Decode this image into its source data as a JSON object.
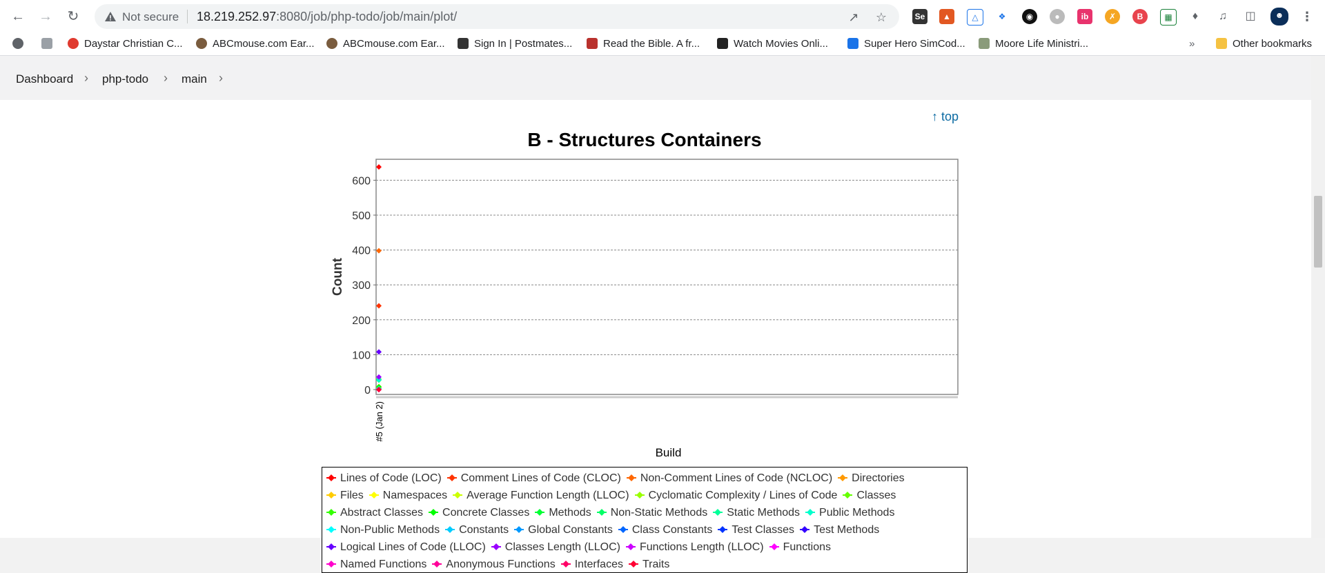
{
  "browser": {
    "url_host": "18.219.252.97",
    "url_rest": ":8080/job/php-todo/job/main/plot/",
    "security_label": "Not secure"
  },
  "bookmarks": [
    {
      "label": "Daystar Christian C...",
      "color": "#e03a2f"
    },
    {
      "label": "ABCmouse.com Ear...",
      "color": "#7a5c3e"
    },
    {
      "label": "ABCmouse.com Ear...",
      "color": "#7a5c3e"
    },
    {
      "label": "Sign In | Postmates...",
      "color": "#333333"
    },
    {
      "label": "Read the Bible. A fr...",
      "color": "#b9312d"
    },
    {
      "label": "Watch Movies Onli...",
      "color": "#222222"
    },
    {
      "label": "Super Hero SimCod...",
      "color": "#1a73e8"
    },
    {
      "label": "Moore Life Ministri...",
      "color": "#8a9b7a"
    }
  ],
  "other_bookmarks": "Other bookmarks",
  "overflow": "»",
  "breadcrumb": [
    "Dashboard",
    "php-todo",
    "main"
  ],
  "top_link": "top",
  "chart_data": {
    "type": "line",
    "title": "B - Structures Containers",
    "xlabel": "Build",
    "ylabel": "Count",
    "categories": [
      "#5 (Jan 2)"
    ],
    "ylim": [
      0,
      660
    ],
    "yticks": [
      0,
      100,
      200,
      300,
      400,
      500,
      600
    ],
    "grid": true,
    "legend_position": "bottom",
    "series": [
      {
        "name": "Lines of Code (LOC)",
        "color": "#ff0000",
        "values": [
          638
        ]
      },
      {
        "name": "Comment Lines of Code (CLOC)",
        "color": "#ff3300",
        "values": [
          240
        ]
      },
      {
        "name": "Non-Comment Lines of Code (NCLOC)",
        "color": "#ff6600",
        "values": [
          398
        ]
      },
      {
        "name": "Directories",
        "color": "#ff9900",
        "values": [
          5
        ]
      },
      {
        "name": "Files",
        "color": "#ffcc00",
        "values": [
          9
        ]
      },
      {
        "name": "Namespaces",
        "color": "#ffff00",
        "values": [
          0
        ]
      },
      {
        "name": "Average Function Length (LLOC)",
        "color": "#ccff00",
        "values": [
          3
        ]
      },
      {
        "name": "Cyclomatic Complexity / Lines of Code",
        "color": "#99ff00",
        "values": [
          0
        ]
      },
      {
        "name": "Classes",
        "color": "#66ff00",
        "values": [
          8
        ]
      },
      {
        "name": "Abstract Classes",
        "color": "#33ff00",
        "values": [
          0
        ]
      },
      {
        "name": "Concrete Classes",
        "color": "#00ff00",
        "values": [
          8
        ]
      },
      {
        "name": "Methods",
        "color": "#00ff33",
        "values": [
          30
        ]
      },
      {
        "name": "Non-Static Methods",
        "color": "#00ff66",
        "values": [
          27
        ]
      },
      {
        "name": "Static Methods",
        "color": "#00ff99",
        "values": [
          3
        ]
      },
      {
        "name": "Public Methods",
        "color": "#00ffcc",
        "values": [
          28
        ]
      },
      {
        "name": "Non-Public Methods",
        "color": "#00ffff",
        "values": [
          2
        ]
      },
      {
        "name": "Constants",
        "color": "#00ccff",
        "values": [
          0
        ]
      },
      {
        "name": "Global Constants",
        "color": "#0099ff",
        "values": [
          0
        ]
      },
      {
        "name": "Class Constants",
        "color": "#0066ff",
        "values": [
          0
        ]
      },
      {
        "name": "Test Classes",
        "color": "#0033ff",
        "values": [
          0
        ]
      },
      {
        "name": "Test Methods",
        "color": "#3300ff",
        "values": [
          0
        ]
      },
      {
        "name": "Logical Lines of Code (LLOC)",
        "color": "#6600ff",
        "values": [
          108
        ]
      },
      {
        "name": "Classes Length (LLOC)",
        "color": "#9900ff",
        "values": [
          36
        ]
      },
      {
        "name": "Functions Length (LLOC)",
        "color": "#cc00ff",
        "values": [
          0
        ]
      },
      {
        "name": "Functions",
        "color": "#ff00ff",
        "values": [
          0
        ]
      },
      {
        "name": "Named Functions",
        "color": "#ff00cc",
        "values": [
          0
        ]
      },
      {
        "name": "Anonymous Functions",
        "color": "#ff0099",
        "values": [
          0
        ]
      },
      {
        "name": "Interfaces",
        "color": "#ff0066",
        "values": [
          0
        ]
      },
      {
        "name": "Traits",
        "color": "#ff0033",
        "values": [
          0
        ]
      }
    ]
  }
}
